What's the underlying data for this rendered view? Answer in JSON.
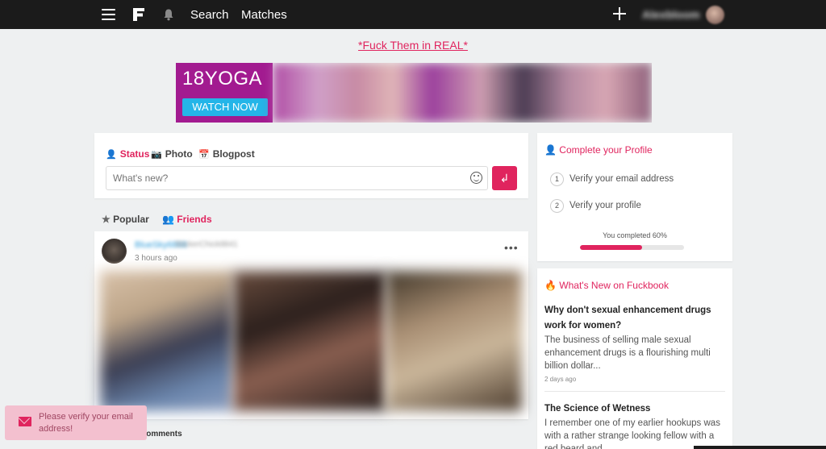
{
  "topbar": {
    "nav": [
      {
        "label": "Search"
      },
      {
        "label": "Matches"
      }
    ],
    "username": "Alexbloom",
    "icons": [
      "menu-icon",
      "logo-icon",
      "bell-icon",
      "plus-icon",
      "avatar"
    ]
  },
  "promo_link": "*Fuck Them in REAL*",
  "banner": {
    "brand": "18YOGA",
    "cta": "WATCH NOW"
  },
  "composer": {
    "tabs": [
      {
        "label": "Status",
        "icon": "user-icon",
        "active": true
      },
      {
        "label": "Photo",
        "icon": "camera-icon",
        "active": false
      },
      {
        "label": "Blogpost",
        "icon": "calendar-icon",
        "active": false
      }
    ],
    "placeholder": "What's new?",
    "send_icon": "enter-icon"
  },
  "feed": {
    "tabs": [
      {
        "label": "Popular",
        "icon": "star-icon"
      },
      {
        "label": "Friends",
        "icon": "users-icon",
        "active": true
      }
    ],
    "post": {
      "author": "BlueSky6868",
      "subtitle": "StickerChick8841",
      "time": "3 hours ago",
      "comments_label": "Comments"
    }
  },
  "profile_card": {
    "title": "Complete your Profile",
    "steps": [
      {
        "num": "1",
        "label": "Verify your email address"
      },
      {
        "num": "2",
        "label": "Verify your profile"
      }
    ],
    "progress_label": "You completed 60%",
    "progress": 0.6
  },
  "news_card": {
    "title": "What's New on Fuckbook",
    "items": [
      {
        "title": "Why don't sexual enhancement drugs work for women?",
        "body": "The business of selling male sexual enhancement drugs is a flourishing multi billion dollar...",
        "date": "2 days ago"
      },
      {
        "title": "The Science of Wetness",
        "body": "I remember one of my earlier hookups was with a rather strange looking fellow with a red beard and..."
      }
    ]
  },
  "toast": {
    "text": "Please verify your email address!"
  },
  "colors": {
    "accent": "#e0245e",
    "topbar": "#1b1b1b",
    "background": "#eef0f1"
  }
}
